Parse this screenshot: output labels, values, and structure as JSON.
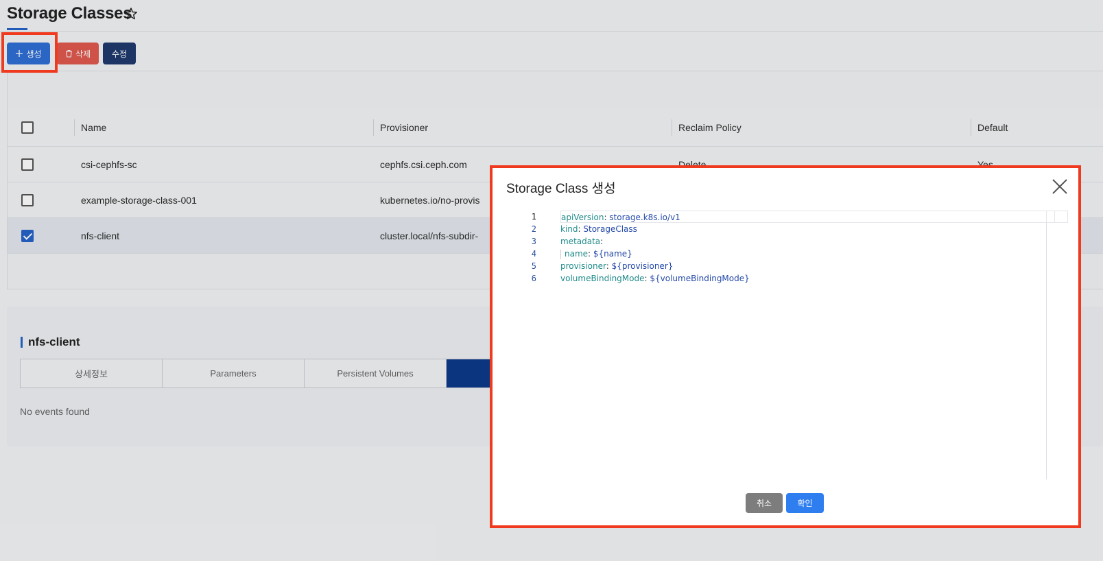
{
  "page": {
    "title": "Storage Classes",
    "star_icon": "star-outline-icon"
  },
  "toolbar": {
    "create_label": "생성",
    "delete_label": "삭제",
    "edit_label": "수정",
    "create_icon": "plus-icon",
    "delete_icon": "trash-icon",
    "colors": {
      "create": "#2f6fd6",
      "delete": "#e15a4f",
      "edit": "#1f3a6e"
    }
  },
  "table": {
    "headers": [
      "Name",
      "Provisioner",
      "Reclaim Policy",
      "Default"
    ],
    "rows": [
      {
        "name": "csi-cephfs-sc",
        "provisioner": "cephfs.csi.ceph.com",
        "reclaim_policy": "Delete",
        "default": "Yes",
        "checked": false
      },
      {
        "name": "example-storage-class-001",
        "provisioner": "kubernetes.io/no-provis",
        "reclaim_policy": "",
        "default": "",
        "checked": false
      },
      {
        "name": "nfs-client",
        "provisioner": "cluster.local/nfs-subdir-",
        "reclaim_policy": "",
        "default": "",
        "checked": true
      }
    ]
  },
  "detail": {
    "title": "nfs-client",
    "tabs": [
      "상세정보",
      "Parameters",
      "Persistent Volumes",
      ""
    ],
    "active_tab_index": 3,
    "empty_text": "No events found"
  },
  "modal": {
    "title": "Storage Class 생성",
    "close_icon": "close-icon",
    "code_lines": [
      {
        "num": "1",
        "key": "apiVersion",
        "value": "storage.k8s.io/v1"
      },
      {
        "num": "2",
        "key": "kind",
        "value": "StorageClass"
      },
      {
        "num": "3",
        "key": "metadata",
        "value": ""
      },
      {
        "num": "4",
        "key": "name",
        "value": "${name}"
      },
      {
        "num": "5",
        "key": "provisioner",
        "value": "${provisioner}"
      },
      {
        "num": "6",
        "key": "volumeBindingMode",
        "value": "${volumeBindingMode}"
      }
    ],
    "cancel_label": "취소",
    "ok_label": "확인"
  }
}
